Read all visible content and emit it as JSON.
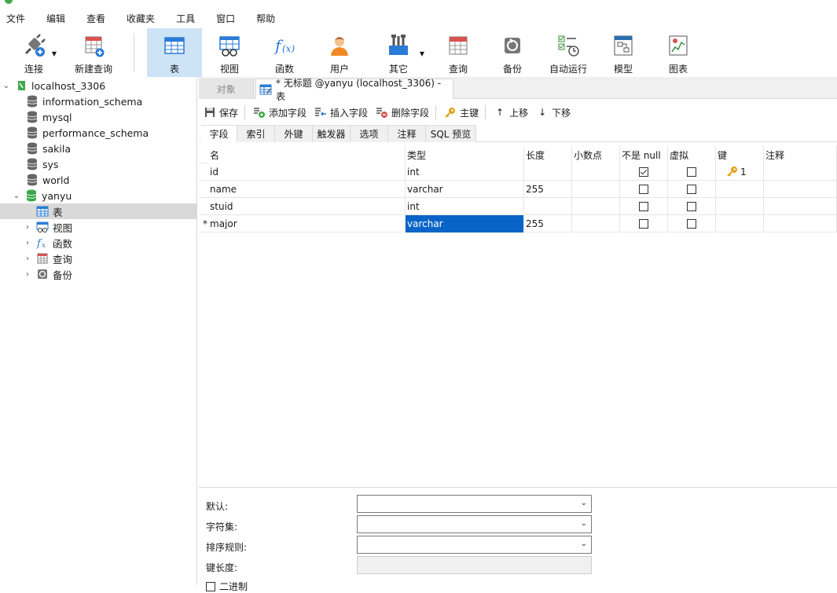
{
  "menu": [
    "文件",
    "编辑",
    "查看",
    "收藏夹",
    "工具",
    "窗口",
    "帮助"
  ],
  "toolbar": {
    "connect": "连接",
    "new_query": "新建查询",
    "table": "表",
    "view": "视图",
    "function": "函数",
    "user": "用户",
    "other": "其它",
    "query": "查询",
    "backup": "备份",
    "autorun": "自动运行",
    "model": "模型",
    "chart": "图表"
  },
  "tree": {
    "connection": "localhost_3306",
    "databases": [
      "information_schema",
      "mysql",
      "performance_schema",
      "sakila",
      "sys",
      "world",
      "yanyu"
    ],
    "yanyu_children": [
      "表",
      "视图",
      "函数",
      "查询",
      "备份"
    ]
  },
  "tabs": {
    "objects": "对象",
    "current": "* 无标题 @yanyu (localhost_3306) - 表"
  },
  "actions": {
    "save": "保存",
    "add_field": "添加字段",
    "insert_field": "插入字段",
    "delete_field": "删除字段",
    "primary_key": "主键",
    "move_up": "上移",
    "move_down": "下移"
  },
  "subtabs": [
    "字段",
    "索引",
    "外键",
    "触发器",
    "选项",
    "注释",
    "SQL 预览"
  ],
  "columns": [
    "名",
    "类型",
    "长度",
    "小数点",
    "不是 null",
    "虚拟",
    "键",
    "注释"
  ],
  "rows": [
    {
      "marker": "",
      "name": "id",
      "type": "int",
      "length": "",
      "decimals": "",
      "not_null": true,
      "virtual": false,
      "key": "1",
      "comment": ""
    },
    {
      "marker": "",
      "name": "name",
      "type": "varchar",
      "length": "255",
      "decimals": "",
      "not_null": false,
      "virtual": false,
      "key": "",
      "comment": ""
    },
    {
      "marker": "",
      "name": "stuid",
      "type": "int",
      "length": "",
      "decimals": "",
      "not_null": false,
      "virtual": false,
      "key": "",
      "comment": ""
    },
    {
      "marker": "*",
      "name": "major",
      "type": "varchar",
      "length": "255",
      "decimals": "",
      "not_null": false,
      "virtual": false,
      "key": "",
      "comment": ""
    }
  ],
  "props": {
    "default": "默认:",
    "charset": "字符集:",
    "collation": "排序规则:",
    "key_length": "键长度:",
    "binary": "二进制"
  },
  "colors": {
    "accent": "#0a64c8",
    "active_toolbar": "#cde3f6",
    "selected_row": "#d9d9d9"
  }
}
